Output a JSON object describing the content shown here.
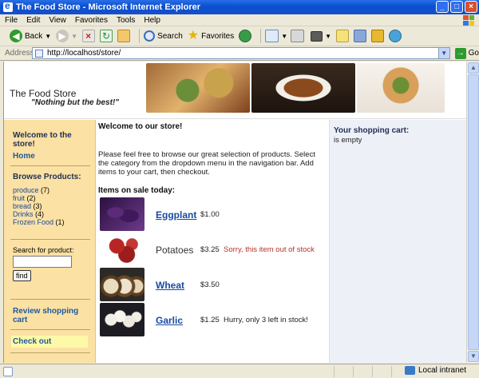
{
  "window": {
    "title": "The Food Store - Microsoft Internet Explorer"
  },
  "menu": [
    "File",
    "Edit",
    "View",
    "Favorites",
    "Tools",
    "Help"
  ],
  "toolbar": {
    "back": "Back",
    "search": "Search",
    "favorites": "Favorites"
  },
  "address": {
    "label": "Address",
    "url": "http://localhost/store/",
    "go": "Go"
  },
  "site": {
    "title": "The Food Store",
    "slogan": "\"Nothing but the best!\""
  },
  "nav": {
    "welcome": "Welcome to the store!",
    "home": "Home",
    "browse": "Browse Products:",
    "categories": [
      {
        "name": "produce",
        "count": "(7)"
      },
      {
        "name": "fruit",
        "count": "(2)"
      },
      {
        "name": "bread",
        "count": "(3)"
      },
      {
        "name": "Drinks",
        "count": "(4)"
      },
      {
        "name": "Frozen Food",
        "count": "(1)"
      }
    ],
    "search_label": "Search for product:",
    "find": "find",
    "review_cart": "Review shopping cart",
    "checkout": "Check out"
  },
  "main": {
    "welcome": "Welcome to our store!",
    "intro": "Please feel free to browse our great selection of products. Select the category from the dropdown menu in the navigation bar. Add items to your cart, then checkout.",
    "sale_heading": "Items on sale today:",
    "products": [
      {
        "name": "Eggplant",
        "price": "$1.00",
        "note": ""
      },
      {
        "name": "Potatoes",
        "price": "$3.25",
        "note": "Sorry, this item out of stock"
      },
      {
        "name": "Wheat",
        "price": "$3.50",
        "note": ""
      },
      {
        "name": "Garlic",
        "price": "$1.25",
        "note": "Hurry, only 3 left in stock!"
      }
    ]
  },
  "cart": {
    "heading": "Your shopping cart:",
    "status": "is empty"
  },
  "status": {
    "zone": "Local intranet"
  },
  "colors": {
    "nav_bg": "#fbe1a3",
    "cart_bg": "#eef0f7",
    "link": "#1a4aa0",
    "warn": "#b8312a",
    "checkout_bg": "#fef9a8"
  }
}
